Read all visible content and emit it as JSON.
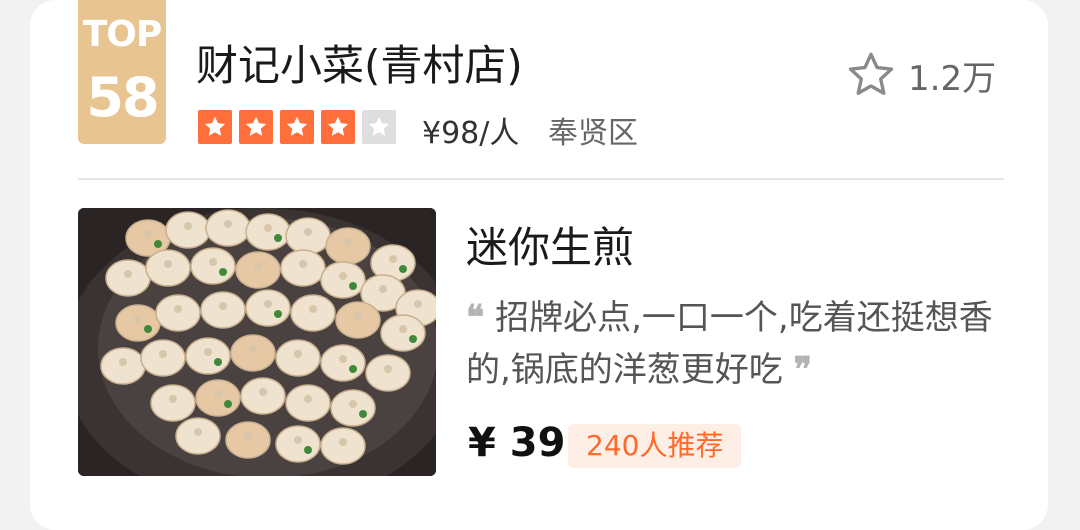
{
  "rank": {
    "label": "TOP",
    "number": "58",
    "color": "#e8c590"
  },
  "shop": {
    "name": "财记小菜(青村店)",
    "rating_stars": 4,
    "rating_max": 5,
    "price_per_person": "¥98/人",
    "district": "奉贤区"
  },
  "favorites": {
    "icon": "star-outline-icon",
    "count": "1.2万"
  },
  "dish": {
    "name": "迷你生煎",
    "review": "招牌必点,一口一个,吃着还挺想香的,锅底的洋葱更好吃",
    "quote_open": "❝",
    "quote_close": "❞",
    "price": "¥ 39",
    "recommend_tag": "240人推荐"
  },
  "colors": {
    "star_on": "#ff6e3b",
    "star_off": "#dedede",
    "accent": "#ff6a2b"
  }
}
